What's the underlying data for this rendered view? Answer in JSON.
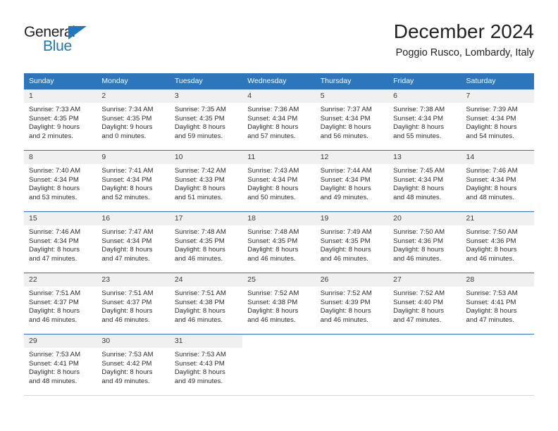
{
  "logo": {
    "word_one": "General",
    "word_two": "Blue",
    "triangle": "triangle-mark",
    "accent_black": "#231f20",
    "accent_blue": "#1f77c4"
  },
  "header": {
    "title": "December 2024",
    "subtitle": "Poggio Rusco, Lombardy, Italy"
  },
  "theme": {
    "header_blue": "#2e76bc",
    "daynum_band": "#f0f0f0",
    "text": "#2b2b2b"
  },
  "calendar": {
    "weekday_headers": [
      "Sunday",
      "Monday",
      "Tuesday",
      "Wednesday",
      "Thursday",
      "Friday",
      "Saturday"
    ],
    "weeks": [
      [
        {
          "day": "1",
          "sunrise": "Sunrise: 7:33 AM",
          "sunset": "Sunset: 4:35 PM",
          "daylight1": "Daylight: 9 hours",
          "daylight2": "and 2 minutes."
        },
        {
          "day": "2",
          "sunrise": "Sunrise: 7:34 AM",
          "sunset": "Sunset: 4:35 PM",
          "daylight1": "Daylight: 9 hours",
          "daylight2": "and 0 minutes."
        },
        {
          "day": "3",
          "sunrise": "Sunrise: 7:35 AM",
          "sunset": "Sunset: 4:35 PM",
          "daylight1": "Daylight: 8 hours",
          "daylight2": "and 59 minutes."
        },
        {
          "day": "4",
          "sunrise": "Sunrise: 7:36 AM",
          "sunset": "Sunset: 4:34 PM",
          "daylight1": "Daylight: 8 hours",
          "daylight2": "and 57 minutes."
        },
        {
          "day": "5",
          "sunrise": "Sunrise: 7:37 AM",
          "sunset": "Sunset: 4:34 PM",
          "daylight1": "Daylight: 8 hours",
          "daylight2": "and 56 minutes."
        },
        {
          "day": "6",
          "sunrise": "Sunrise: 7:38 AM",
          "sunset": "Sunset: 4:34 PM",
          "daylight1": "Daylight: 8 hours",
          "daylight2": "and 55 minutes."
        },
        {
          "day": "7",
          "sunrise": "Sunrise: 7:39 AM",
          "sunset": "Sunset: 4:34 PM",
          "daylight1": "Daylight: 8 hours",
          "daylight2": "and 54 minutes."
        }
      ],
      [
        {
          "day": "8",
          "sunrise": "Sunrise: 7:40 AM",
          "sunset": "Sunset: 4:34 PM",
          "daylight1": "Daylight: 8 hours",
          "daylight2": "and 53 minutes."
        },
        {
          "day": "9",
          "sunrise": "Sunrise: 7:41 AM",
          "sunset": "Sunset: 4:34 PM",
          "daylight1": "Daylight: 8 hours",
          "daylight2": "and 52 minutes."
        },
        {
          "day": "10",
          "sunrise": "Sunrise: 7:42 AM",
          "sunset": "Sunset: 4:33 PM",
          "daylight1": "Daylight: 8 hours",
          "daylight2": "and 51 minutes."
        },
        {
          "day": "11",
          "sunrise": "Sunrise: 7:43 AM",
          "sunset": "Sunset: 4:34 PM",
          "daylight1": "Daylight: 8 hours",
          "daylight2": "and 50 minutes."
        },
        {
          "day": "12",
          "sunrise": "Sunrise: 7:44 AM",
          "sunset": "Sunset: 4:34 PM",
          "daylight1": "Daylight: 8 hours",
          "daylight2": "and 49 minutes."
        },
        {
          "day": "13",
          "sunrise": "Sunrise: 7:45 AM",
          "sunset": "Sunset: 4:34 PM",
          "daylight1": "Daylight: 8 hours",
          "daylight2": "and 48 minutes."
        },
        {
          "day": "14",
          "sunrise": "Sunrise: 7:46 AM",
          "sunset": "Sunset: 4:34 PM",
          "daylight1": "Daylight: 8 hours",
          "daylight2": "and 48 minutes."
        }
      ],
      [
        {
          "day": "15",
          "sunrise": "Sunrise: 7:46 AM",
          "sunset": "Sunset: 4:34 PM",
          "daylight1": "Daylight: 8 hours",
          "daylight2": "and 47 minutes."
        },
        {
          "day": "16",
          "sunrise": "Sunrise: 7:47 AM",
          "sunset": "Sunset: 4:34 PM",
          "daylight1": "Daylight: 8 hours",
          "daylight2": "and 47 minutes."
        },
        {
          "day": "17",
          "sunrise": "Sunrise: 7:48 AM",
          "sunset": "Sunset: 4:35 PM",
          "daylight1": "Daylight: 8 hours",
          "daylight2": "and 46 minutes."
        },
        {
          "day": "18",
          "sunrise": "Sunrise: 7:48 AM",
          "sunset": "Sunset: 4:35 PM",
          "daylight1": "Daylight: 8 hours",
          "daylight2": "and 46 minutes."
        },
        {
          "day": "19",
          "sunrise": "Sunrise: 7:49 AM",
          "sunset": "Sunset: 4:35 PM",
          "daylight1": "Daylight: 8 hours",
          "daylight2": "and 46 minutes."
        },
        {
          "day": "20",
          "sunrise": "Sunrise: 7:50 AM",
          "sunset": "Sunset: 4:36 PM",
          "daylight1": "Daylight: 8 hours",
          "daylight2": "and 46 minutes."
        },
        {
          "day": "21",
          "sunrise": "Sunrise: 7:50 AM",
          "sunset": "Sunset: 4:36 PM",
          "daylight1": "Daylight: 8 hours",
          "daylight2": "and 46 minutes."
        }
      ],
      [
        {
          "day": "22",
          "sunrise": "Sunrise: 7:51 AM",
          "sunset": "Sunset: 4:37 PM",
          "daylight1": "Daylight: 8 hours",
          "daylight2": "and 46 minutes."
        },
        {
          "day": "23",
          "sunrise": "Sunrise: 7:51 AM",
          "sunset": "Sunset: 4:37 PM",
          "daylight1": "Daylight: 8 hours",
          "daylight2": "and 46 minutes."
        },
        {
          "day": "24",
          "sunrise": "Sunrise: 7:51 AM",
          "sunset": "Sunset: 4:38 PM",
          "daylight1": "Daylight: 8 hours",
          "daylight2": "and 46 minutes."
        },
        {
          "day": "25",
          "sunrise": "Sunrise: 7:52 AM",
          "sunset": "Sunset: 4:38 PM",
          "daylight1": "Daylight: 8 hours",
          "daylight2": "and 46 minutes."
        },
        {
          "day": "26",
          "sunrise": "Sunrise: 7:52 AM",
          "sunset": "Sunset: 4:39 PM",
          "daylight1": "Daylight: 8 hours",
          "daylight2": "and 46 minutes."
        },
        {
          "day": "27",
          "sunrise": "Sunrise: 7:52 AM",
          "sunset": "Sunset: 4:40 PM",
          "daylight1": "Daylight: 8 hours",
          "daylight2": "and 47 minutes."
        },
        {
          "day": "28",
          "sunrise": "Sunrise: 7:53 AM",
          "sunset": "Sunset: 4:41 PM",
          "daylight1": "Daylight: 8 hours",
          "daylight2": "and 47 minutes."
        }
      ],
      [
        {
          "day": "29",
          "sunrise": "Sunrise: 7:53 AM",
          "sunset": "Sunset: 4:41 PM",
          "daylight1": "Daylight: 8 hours",
          "daylight2": "and 48 minutes."
        },
        {
          "day": "30",
          "sunrise": "Sunrise: 7:53 AM",
          "sunset": "Sunset: 4:42 PM",
          "daylight1": "Daylight: 8 hours",
          "daylight2": "and 49 minutes."
        },
        {
          "day": "31",
          "sunrise": "Sunrise: 7:53 AM",
          "sunset": "Sunset: 4:43 PM",
          "daylight1": "Daylight: 8 hours",
          "daylight2": "and 49 minutes."
        },
        {
          "day": "",
          "sunrise": "",
          "sunset": "",
          "daylight1": "",
          "daylight2": ""
        },
        {
          "day": "",
          "sunrise": "",
          "sunset": "",
          "daylight1": "",
          "daylight2": ""
        },
        {
          "day": "",
          "sunrise": "",
          "sunset": "",
          "daylight1": "",
          "daylight2": ""
        },
        {
          "day": "",
          "sunrise": "",
          "sunset": "",
          "daylight1": "",
          "daylight2": ""
        }
      ]
    ]
  }
}
